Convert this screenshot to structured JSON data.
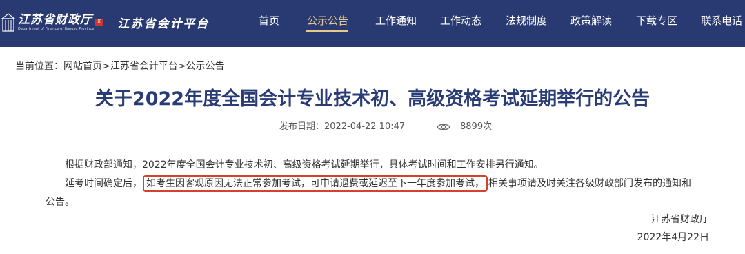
{
  "header": {
    "logo_cn": "江苏省财政厅",
    "logo_en": "Department of Finance of Jiangsu Province",
    "seal_text": "印",
    "platform_name": "江苏省会计平台",
    "nav": [
      {
        "label": "首页",
        "active": false
      },
      {
        "label": "公示公告",
        "active": true
      },
      {
        "label": "工作通知",
        "active": false
      },
      {
        "label": "工作动态",
        "active": false
      },
      {
        "label": "法规制度",
        "active": false
      },
      {
        "label": "政策解读",
        "active": false
      },
      {
        "label": "下载专区",
        "active": false
      },
      {
        "label": "联系电话",
        "active": false
      }
    ],
    "colors": {
      "bar": "#283a71",
      "active": "#e6c98f"
    }
  },
  "breadcrumb": {
    "prefix": "当前位置：",
    "items": [
      "网站首页",
      "江苏省会计平台",
      "公示公告"
    ],
    "separator": ">"
  },
  "article": {
    "title": "关于2022年度全国会计专业技术初、高级资格考试延期举行的公告",
    "publish_label": "发布日期：2022-04-22  10:47",
    "views": "8899次",
    "views_icon": "eye-icon",
    "para1": "根据财政部通知，2022年度全国会计专业技术初、高级资格考试延期举行，具体考试时间和工作安排另行通知。",
    "para2_before": "延考时间确定后，",
    "para2_highlight": "如考生因客观原因无法正常参加考试，可申请退费或延迟至下一年度参加考试，",
    "para2_after": "相关事项请及时关注各级财政部门发布的通知和",
    "para2_cont": "公告。",
    "sign_org": "江苏省财政厅",
    "sign_date": "2022年4月22日",
    "highlight_color": "#d2422e"
  }
}
